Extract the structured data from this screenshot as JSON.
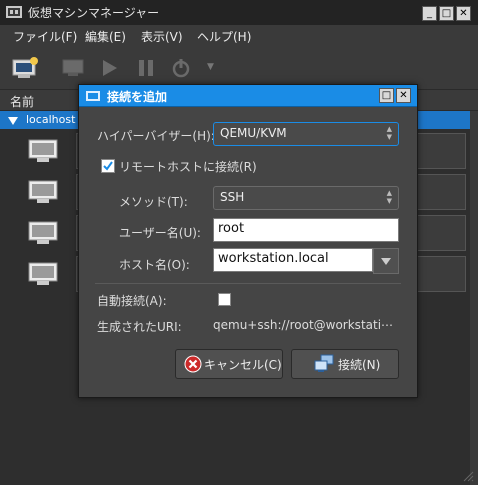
{
  "main_window": {
    "title": "仮想マシンマネージャー",
    "controls": [
      "_",
      "□",
      "✕"
    ],
    "menu": [
      "ファイル(F)",
      "編集(E)",
      "表示(V)",
      "ヘルプ(H)"
    ],
    "list_header": "名前",
    "connection_label": "localhost (",
    "toolbar_more": "▼"
  },
  "dialog": {
    "title": "接続を追加",
    "controls": [
      "□",
      "✕"
    ],
    "hypervisor_label": "ハイパーバイザー(H):",
    "hypervisor_value": "QEMU/KVM",
    "remote_checkbox_label": "リモートホストに接続(R)",
    "method_label": "メソッド(T):",
    "method_value": "SSH",
    "username_label": "ユーザー名(U):",
    "username_value": "root",
    "hostname_label": "ホスト名(O):",
    "hostname_value": "workstation.local",
    "autoconnect_label": "自動接続(A):",
    "uri_label": "生成されたURI:",
    "uri_value": "qemu+ssh://root@workstati⋯",
    "cancel_label": "キャンセル(C)",
    "connect_label": "接続(N)"
  },
  "colors": {
    "accent": "#1a8ce6",
    "selection": "#1d76c8",
    "cancel_icon": "#cc2a2a"
  }
}
